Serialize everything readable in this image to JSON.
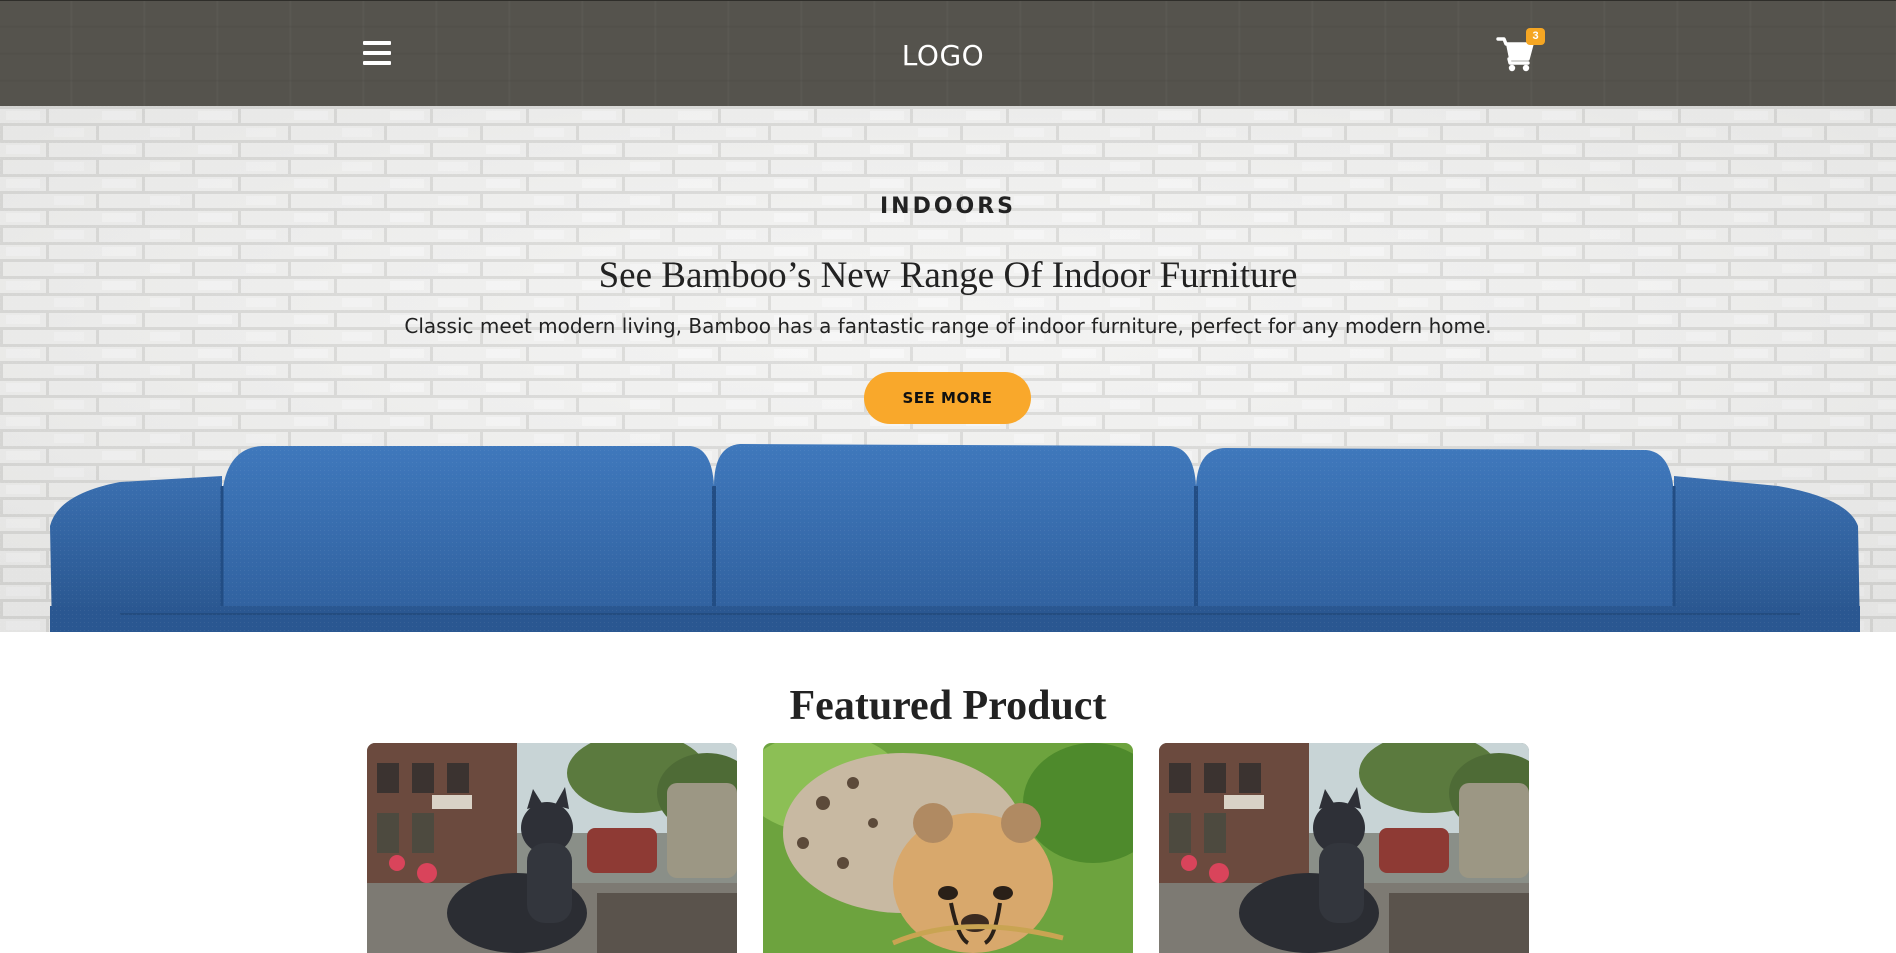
{
  "header": {
    "menu_icon": "hamburger-menu-icon",
    "logo_text": "LOGO",
    "cart_icon": "shopping-cart-icon",
    "cart_count": "3",
    "background_color": "#55534d",
    "badge_color": "#f5a623"
  },
  "hero": {
    "eyebrow": "INDOORS",
    "title": "See Bamboo’s New Range Of Indoor Furniture",
    "description": "Classic meet modern living, Bamboo has a fantastic range of indoor furniture, perfect for any modern home.",
    "button_label": "SEE MORE",
    "button_color": "#f9a82b",
    "sofa_color": "#3a6fb0"
  },
  "featured": {
    "title": "Featured Product",
    "products": [
      {
        "image": "cat-statue-street-photo"
      },
      {
        "image": "cheetah-cub-photo"
      },
      {
        "image": "cat-statue-street-photo"
      }
    ]
  }
}
